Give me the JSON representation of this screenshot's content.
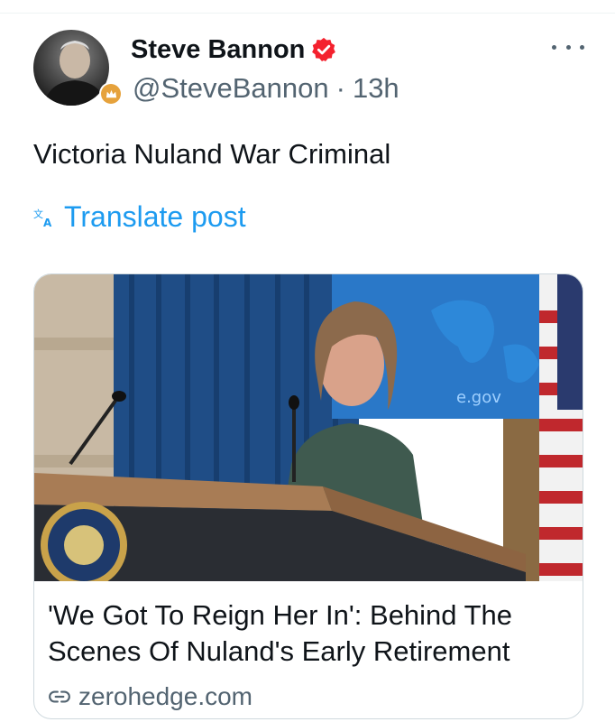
{
  "post": {
    "author": {
      "display_name": "Steve Bannon",
      "handle": "@SteveBannon",
      "separator": "·",
      "time": "13h",
      "verified": true,
      "badge_icon": "crown-badge-icon"
    },
    "text": "Victoria Nuland War Criminal",
    "translate_label": "Translate post",
    "link_card": {
      "image_sign_text": "e.gov",
      "title": "'We Got To Reign Her In': Behind The Scenes Of Nuland's Early Retirement",
      "domain": "zerohedge.com"
    }
  },
  "colors": {
    "accent": "#1d9bf0",
    "verified": "#f4212e",
    "secondary_text": "#536471"
  }
}
